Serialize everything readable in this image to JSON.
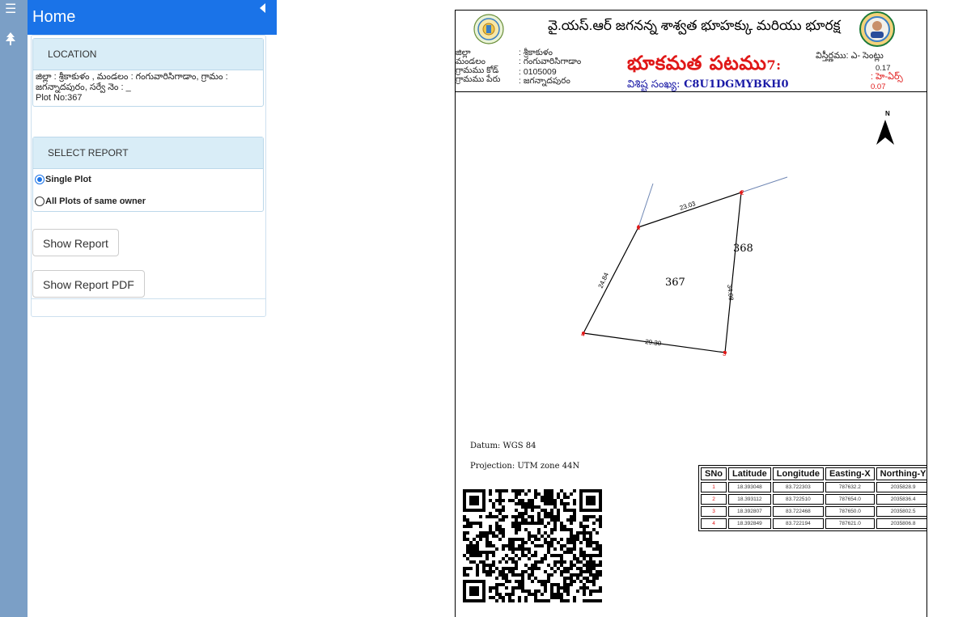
{
  "header": {
    "title": "Home"
  },
  "location": {
    "heading": "LOCATION",
    "line1": "జిల్లా : శ్రీకాకుళం , మండలం : గంగువారిసిగాడాం, గ్రామం :",
    "line2": "జగన్నాదపురం, సర్వే నెం : _",
    "plot": "Plot No:367"
  },
  "report": {
    "heading": "SELECT REPORT",
    "options": [
      {
        "label": "Single Plot",
        "selected": true
      },
      {
        "label": "All Plots of same owner",
        "selected": false
      }
    ],
    "show_report": "Show Report",
    "show_report_pdf": "Show Report PDF"
  },
  "document": {
    "title": "వై.యస్.ఆర్ జగనన్న శాశ్వత భూహక్కు మరియు భూరక్ష",
    "meta_keys": [
      "జిల్లా",
      "మండలం",
      "గ్రామము కోడ్",
      "గ్రామము పేరు"
    ],
    "meta_values": [
      ": శ్రీకాకుళం",
      ": గంగువారిసిగాడాం",
      ": 0105009",
      ": జగన్నాదపురం"
    ],
    "big_title": "భూకమత పటము",
    "big_title_suffix": "7:",
    "uid_label": "విశిష్ట సంఖ్య:",
    "uid_value": "C8U1DGMYBKH0",
    "extent_label": "విస్తీర్ణము: ఎ- సెంట్లు",
    "extent_value": "0.17",
    "extent_label2": ": హె-ఏర్స్",
    "extent_value2": "0.07",
    "north": "N",
    "plot_number": "367",
    "neighbor_number": "368",
    "edges": [
      "23.03",
      "34.08",
      "29.30",
      "24.84"
    ],
    "vertices": [
      "1",
      "2",
      "3",
      "4"
    ],
    "datum": "Datum: WGS 84",
    "projection": "Projection: UTM zone 44N"
  },
  "coords_table": {
    "headers": [
      "SNo",
      "Latitude",
      "Longitude",
      "Easting-X",
      "Northing-Y"
    ],
    "rows": [
      [
        "1",
        "18.393048",
        "83.722303",
        "787632.2",
        "2035828.9"
      ],
      [
        "2",
        "18.393112",
        "83.722510",
        "787654.0",
        "2035836.4"
      ],
      [
        "3",
        "18.392807",
        "83.722468",
        "787650.0",
        "2035802.5"
      ],
      [
        "4",
        "18.392849",
        "83.722194",
        "787621.0",
        "2035806.8"
      ]
    ]
  },
  "colors": {
    "header": "#1a73e8",
    "rail": "#7b9fc6",
    "card_header": "#d9edf7",
    "title_red": "#e01818",
    "uid_blue": "#1a1aa6"
  }
}
